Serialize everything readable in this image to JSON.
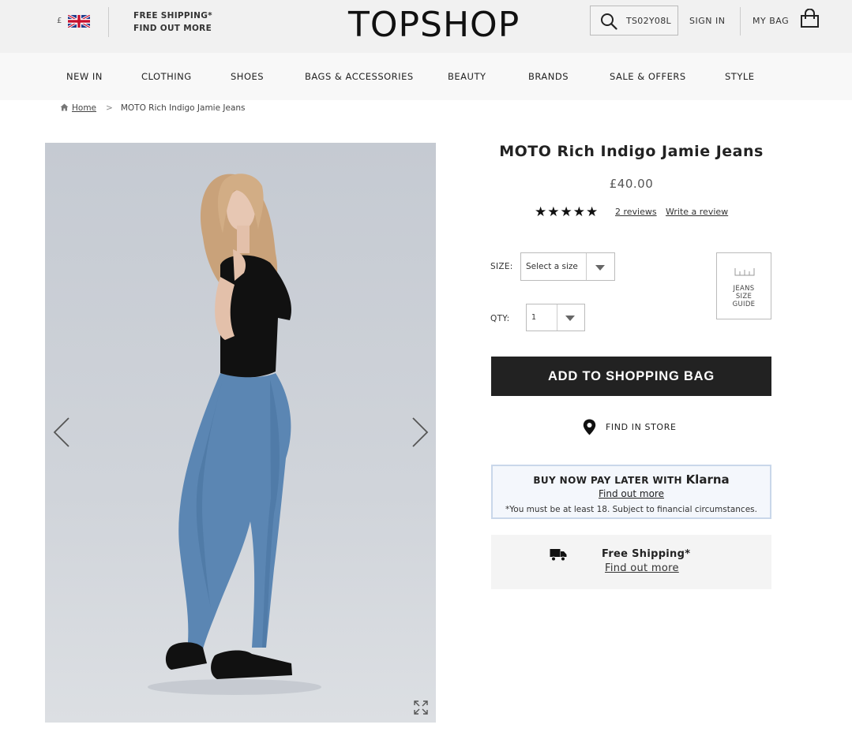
{
  "header": {
    "currency_symbol": "£",
    "flag_icon": "uk-flag-icon",
    "promo_line1": "FREE SHIPPING*",
    "promo_line2": "FIND OUT MORE",
    "logo": "TOPSHOP",
    "search_value": "TS02Y08L",
    "sign_in": "SIGN IN",
    "my_bag": "MY BAG"
  },
  "nav": {
    "items": [
      "NEW IN",
      "CLOTHING",
      "SHOES",
      "BAGS & ACCESSORIES",
      "BEAUTY",
      "BRANDS",
      "SALE & OFFERS",
      "STYLE"
    ]
  },
  "breadcrumb": {
    "home": "Home",
    "separator": ">",
    "current": "MOTO Rich Indigo Jamie Jeans"
  },
  "product": {
    "title": "MOTO Rich Indigo Jamie Jeans",
    "price": "£40.00",
    "rating_stars": 5,
    "stars": "★★★★★",
    "reviews_link": "2 reviews",
    "write_review": "Write a review",
    "size_label": "SIZE:",
    "size_placeholder": "Select a size",
    "qty_label": "QTY:",
    "qty_value": "1",
    "size_guide_line1": "JEANS",
    "size_guide_line2": "SIZE",
    "size_guide_line3": "GUIDE",
    "add_to_bag": "ADD TO SHOPPING BAG",
    "find_in_store": "FIND IN STORE"
  },
  "klarna": {
    "heading": "BUY NOW PAY LATER WITH",
    "brand": "Klarna",
    "link": "Find out more",
    "note": "*You must be at least 18. Subject to financial circumstances."
  },
  "shipping": {
    "title": "Free Shipping*",
    "link": "Find out more"
  },
  "colors": {
    "topbar_bg": "#f1f1f1",
    "nav_bg": "#f8f8f8",
    "button_bg": "#222222",
    "klarna_border": "#c9d7ea"
  }
}
